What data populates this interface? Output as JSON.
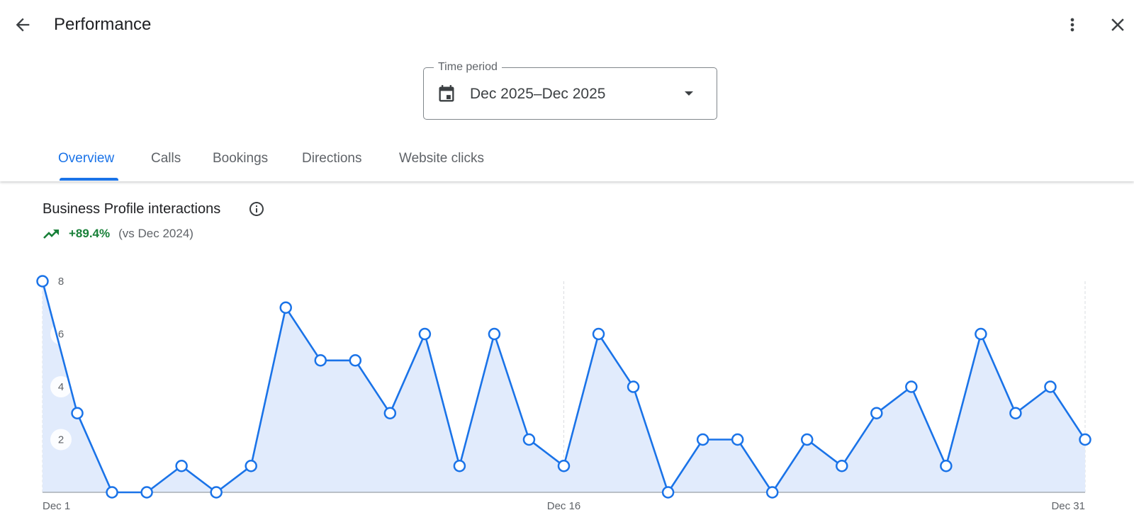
{
  "header": {
    "title": "Performance",
    "back_icon": "arrow-back-icon",
    "more_icon": "more-vert-icon",
    "close_icon": "close-icon"
  },
  "time_period": {
    "label": "Time period",
    "value": "Dec 2025–Dec 2025",
    "icon": "calendar-icon",
    "dropdown_icon": "arrow-drop-down-icon"
  },
  "tabs": [
    {
      "label": "Overview",
      "active": true
    },
    {
      "label": "Calls",
      "active": false
    },
    {
      "label": "Bookings",
      "active": false
    },
    {
      "label": "Directions",
      "active": false
    },
    {
      "label": "Website clicks",
      "active": false
    }
  ],
  "card": {
    "title": "Business Profile interactions",
    "info_icon": "info-icon",
    "trend_icon": "trending-up-icon",
    "trend_value": "+89.4%",
    "trend_compare": "(vs Dec 2024)"
  },
  "colors": {
    "accent": "#1a73e8",
    "area_fill": "#e1ebfc",
    "positive": "#188038",
    "text_secondary": "#5f6368"
  },
  "chart_data": {
    "type": "area",
    "title": "",
    "xlabel": "",
    "ylabel": "",
    "x": [
      1,
      2,
      3,
      4,
      5,
      6,
      7,
      8,
      9,
      10,
      11,
      12,
      13,
      14,
      15,
      16,
      17,
      18,
      19,
      20,
      21,
      22,
      23,
      24,
      25,
      26,
      27,
      28,
      29,
      30,
      31
    ],
    "x_ticks": [
      {
        "day": 1,
        "label": "Dec 1"
      },
      {
        "day": 16,
        "label": "Dec 16"
      },
      {
        "day": 31,
        "label": "Dec 31"
      }
    ],
    "y_ticks": [
      2,
      4,
      6,
      8
    ],
    "ylim": [
      0,
      8
    ],
    "grid": "vertical dashed lines at labeled days",
    "series": [
      {
        "values": [
          8,
          3,
          0,
          0,
          1,
          0,
          1,
          7,
          5,
          5,
          3,
          6,
          1,
          6,
          2,
          1,
          6,
          4,
          0,
          2,
          2,
          0,
          2,
          1,
          3,
          4,
          1,
          6,
          3,
          4,
          2
        ]
      }
    ]
  }
}
